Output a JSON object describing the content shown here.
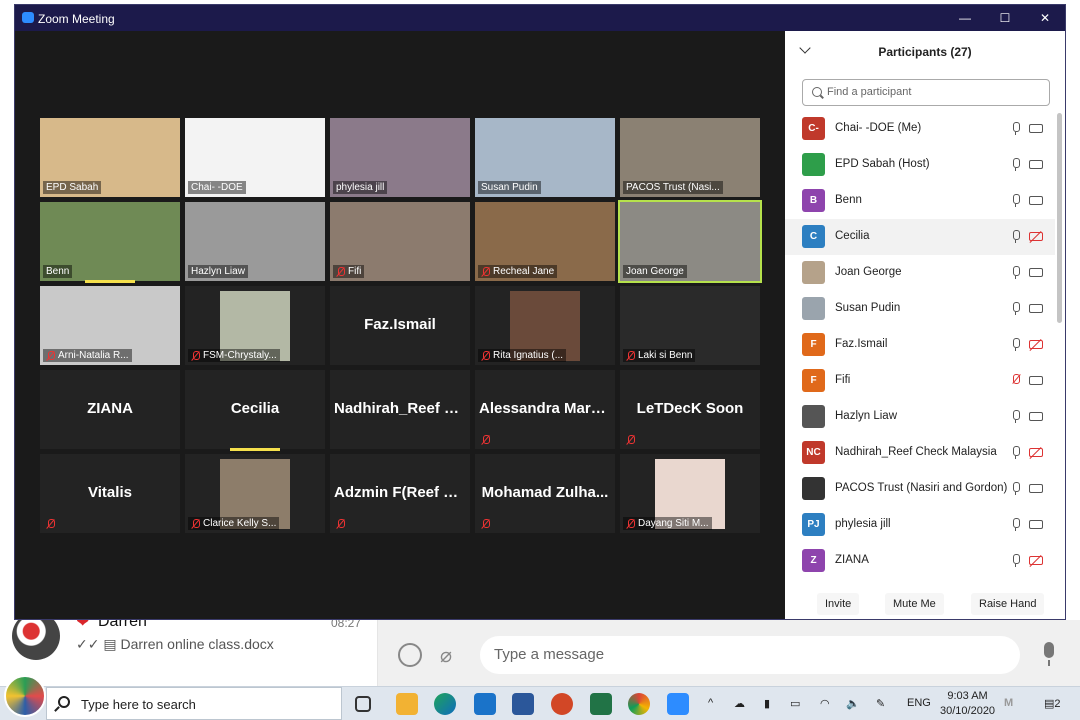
{
  "window": {
    "title": "Zoom Meeting"
  },
  "tiles": [
    {
      "name": "EPD Sabah",
      "muted": false,
      "color": "#d7b98a",
      "big": false
    },
    {
      "name": "Chai- -DOE",
      "muted": false,
      "color": "#f3f3f3",
      "big": false
    },
    {
      "name": "phylesia jill",
      "muted": false,
      "color": "#8b7a8a",
      "big": false
    },
    {
      "name": "Susan Pudin",
      "muted": false,
      "color": "#a7b7c8",
      "big": false
    },
    {
      "name": "PACOS Trust (Nasi...",
      "muted": false,
      "color": "#8b8173",
      "big": false
    },
    {
      "name": "Benn",
      "muted": false,
      "color": "#6f8a55",
      "big": false
    },
    {
      "name": "Hazlyn Liaw",
      "muted": false,
      "color": "#9a9a9a",
      "big": false
    },
    {
      "name": "Fifi",
      "muted": true,
      "color": "#8c7b6e",
      "big": false
    },
    {
      "name": "Recheal Jane",
      "muted": true,
      "color": "#8a6a4a",
      "big": false
    },
    {
      "name": "Joan George",
      "muted": false,
      "color": "#8c8a84",
      "big": false
    },
    {
      "name": "Arni-Natalia R...",
      "muted": true,
      "color": "#c9c9c9",
      "big": false
    },
    {
      "name": "FSM-Chrystaly...",
      "muted": true,
      "color": "#b3b8a5",
      "big": false
    },
    {
      "name": "Faz.Ismail",
      "muted": false,
      "color": "",
      "big": true
    },
    {
      "name": "Rita Ignatius (...",
      "muted": true,
      "color": "#6a4a3a",
      "big": false
    },
    {
      "name": "Laki si Benn",
      "muted": true,
      "color": "#2a2a2a",
      "big": false
    },
    {
      "name": "ZIANA",
      "muted": false,
      "color": "",
      "big": true
    },
    {
      "name": "Cecilia",
      "muted": false,
      "color": "",
      "big": true
    },
    {
      "name": "Nadhirah_Reef C...",
      "muted": false,
      "color": "",
      "big": true
    },
    {
      "name": "Alessandra Mark...",
      "muted": true,
      "color": "",
      "big": true
    },
    {
      "name": "LeTDecK Soon",
      "muted": true,
      "color": "",
      "big": true
    },
    {
      "name": "Vitalis",
      "muted": true,
      "color": "",
      "big": true
    },
    {
      "name": "Clarice Kelly S...",
      "muted": true,
      "color": "#8d7d6a",
      "big": false
    },
    {
      "name": "Adzmin F(Reef C...",
      "muted": true,
      "color": "",
      "big": true
    },
    {
      "name": "Mohamad Zulha...",
      "muted": true,
      "color": "",
      "big": true
    },
    {
      "name": "Dayang Siti M...",
      "muted": true,
      "color": "#e9d7cf",
      "big": false
    }
  ],
  "participants": {
    "title": "Participants (27)",
    "search_placeholder": "Find a participant",
    "items": [
      {
        "initials": "C-",
        "name": "Chai- -DOE (Me)",
        "color": "#c0392b",
        "mic_muted": false,
        "cam_off": false
      },
      {
        "initials": "",
        "name": "EPD Sabah (Host)",
        "color": "#2e9e4a",
        "mic_muted": false,
        "cam_off": false
      },
      {
        "initials": "B",
        "name": "Benn",
        "color": "#8e44ad",
        "mic_muted": false,
        "cam_off": false
      },
      {
        "initials": "C",
        "name": "Cecilia",
        "color": "#2d7fc1",
        "mic_muted": false,
        "cam_off": true
      },
      {
        "initials": "",
        "name": "Joan George",
        "color": "#b5a28a",
        "mic_muted": false,
        "cam_off": false
      },
      {
        "initials": "",
        "name": "Susan Pudin",
        "color": "#9aa4ad",
        "mic_muted": false,
        "cam_off": false
      },
      {
        "initials": "F",
        "name": "Faz.Ismail",
        "color": "#e0691a",
        "mic_muted": false,
        "cam_off": true
      },
      {
        "initials": "F",
        "name": "Fifi",
        "color": "#e0691a",
        "mic_muted": true,
        "cam_off": false
      },
      {
        "initials": "",
        "name": "Hazlyn Liaw",
        "color": "#555555",
        "mic_muted": false,
        "cam_off": false
      },
      {
        "initials": "NC",
        "name": "Nadhirah_Reef Check Malaysia",
        "color": "#c0392b",
        "mic_muted": false,
        "cam_off": true
      },
      {
        "initials": "",
        "name": "PACOS Trust (Nasiri and Gordon)",
        "color": "#333333",
        "mic_muted": false,
        "cam_off": false
      },
      {
        "initials": "PJ",
        "name": "phylesia jill",
        "color": "#2d7fc1",
        "mic_muted": false,
        "cam_off": false
      },
      {
        "initials": "Z",
        "name": "ZIANA",
        "color": "#8e44ad",
        "mic_muted": false,
        "cam_off": true
      }
    ],
    "invite": "Invite",
    "mute_me": "Mute Me",
    "raise_hand": "Raise Hand"
  },
  "chat": {
    "contact": "Darren",
    "time": "08:27",
    "last_message": "Darren online class.docx",
    "compose_placeholder": "Type a message"
  },
  "taskbar": {
    "search_placeholder": "Type here to search",
    "lang": "ENG",
    "time": "9:03 AM",
    "date": "30/10/2020",
    "notif_count": "2"
  }
}
